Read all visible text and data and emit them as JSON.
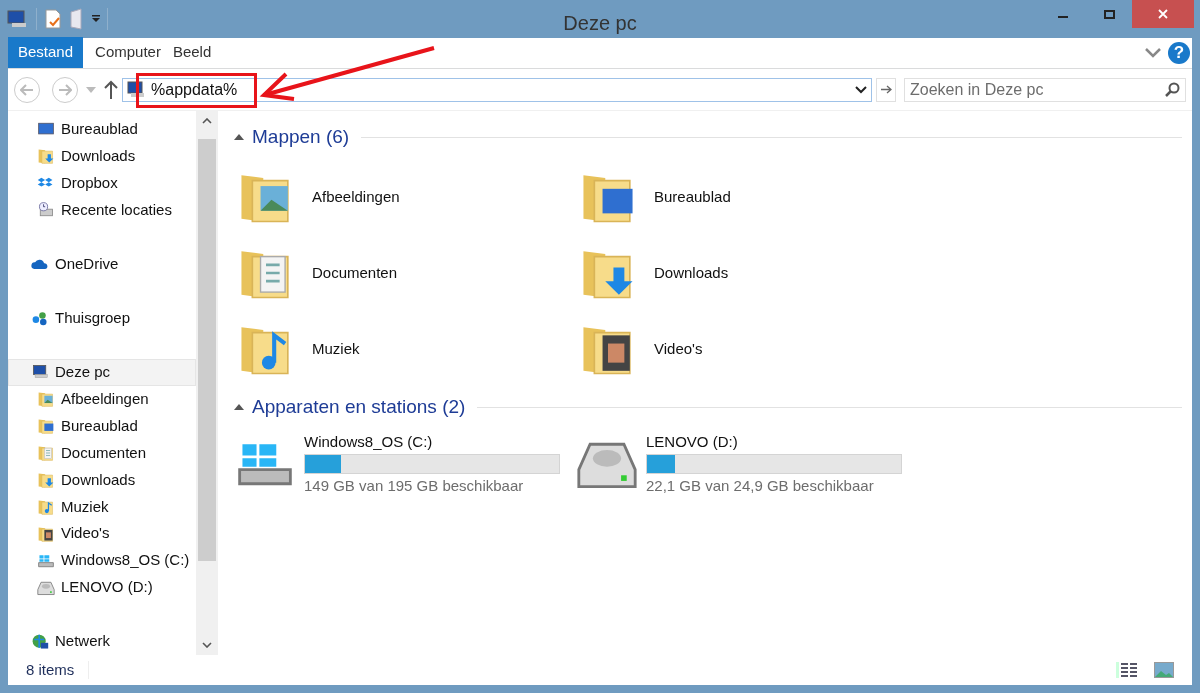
{
  "window": {
    "title": "Deze pc"
  },
  "ribbon": {
    "tabs": [
      {
        "label": "Bestand",
        "kind": "file",
        "selected": false
      },
      {
        "label": "Computer",
        "kind": "tab",
        "selected": false
      },
      {
        "label": "Beeld",
        "kind": "tab",
        "selected": false
      }
    ],
    "help": "?"
  },
  "address_bar": {
    "value": "%appdata%",
    "back_disabled": true,
    "forward_disabled": true
  },
  "search": {
    "placeholder": "Zoeken in Deze pc"
  },
  "annotation": {
    "highlight": true,
    "arrow": true
  },
  "sidebar": {
    "tree": [
      {
        "kind": "group",
        "children": [
          {
            "label": "Bureaublad",
            "kind": "desktop",
            "selected": false
          },
          {
            "label": "Downloads",
            "kind": "folder-download",
            "selected": false
          },
          {
            "label": "Dropbox",
            "kind": "dropbox",
            "selected": false
          },
          {
            "label": "Recente locaties",
            "kind": "recent",
            "selected": false
          }
        ]
      },
      {
        "label": "OneDrive",
        "kind": "cloud",
        "selected": false
      },
      {
        "label": "Thuisgroep",
        "kind": "homegroup",
        "selected": false
      },
      {
        "label": "Deze pc",
        "kind": "computer",
        "selected": true,
        "children": [
          {
            "label": "Afbeeldingen",
            "kind": "folder-pictures",
            "selected": false
          },
          {
            "label": "Bureaublad",
            "kind": "folder-desktop",
            "selected": false
          },
          {
            "label": "Documenten",
            "kind": "folder-documents",
            "selected": false
          },
          {
            "label": "Downloads",
            "kind": "folder-download",
            "selected": false
          },
          {
            "label": "Muziek",
            "kind": "folder-music",
            "selected": false
          },
          {
            "label": "Video's",
            "kind": "folder-video",
            "selected": false
          },
          {
            "label": "Windows8_OS (C:)",
            "kind": "drive-windows",
            "selected": false
          },
          {
            "label": "LENOVO (D:)",
            "kind": "drive",
            "selected": false
          }
        ]
      },
      {
        "label": "Netwerk",
        "kind": "network",
        "selected": false
      }
    ]
  },
  "sections": [
    {
      "title": "Mappen (6)",
      "expanded": true,
      "kind": "folders",
      "items": [
        {
          "label": "Afbeeldingen",
          "kind": "folder-pictures"
        },
        {
          "label": "Bureaublad",
          "kind": "folder-desktop"
        },
        {
          "label": "Documenten",
          "kind": "folder-documents"
        },
        {
          "label": "Downloads",
          "kind": "folder-download"
        },
        {
          "label": "Muziek",
          "kind": "folder-music"
        },
        {
          "label": "Video's",
          "kind": "folder-video"
        }
      ]
    },
    {
      "title": "Apparaten en stations (2)",
      "expanded": true,
      "kind": "drives",
      "items": [
        {
          "label": "Windows8_OS (C:)",
          "kind": "drive-windows",
          "level": 0.14,
          "reading": "149 GB van 195 GB beschikbaar"
        },
        {
          "label": "LENOVO (D:)",
          "kind": "drive",
          "level": 0.11,
          "reading": "22,1 GB van 24,9 GB beschikbaar"
        }
      ]
    }
  ],
  "status_bar": {
    "count": "8 items"
  }
}
